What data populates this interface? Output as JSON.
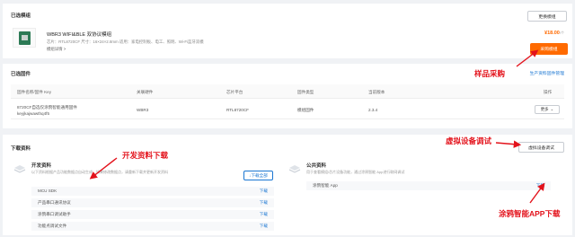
{
  "selected_module": {
    "title": "已选模组",
    "change_label": "更换模组",
    "name": "WBR3 WIFI&BLE 双协议模组",
    "specs": "芯片：RTL8720CF   尺寸：16×24×2.8mm   适用：家电控制板、电工、照明、Wi-Fi蓝牙双模",
    "detail_label": "模组详情 >",
    "price": "¥18.00",
    "price_unit": "/个",
    "buy_label": "采购模组"
  },
  "firmware": {
    "title": "已选固件",
    "manage_label": "生产资料固件管理",
    "columns": [
      "固件名称/固件 Key",
      "关联硬件",
      "芯片平台",
      "固件类型",
      "当前版本",
      "操作"
    ],
    "row": {
      "name": "8720CF自选仅涂鸦智能通用固件",
      "key": "keyjkajwawthq4f5",
      "hardware": "WBR3",
      "chip": "RTL8720CF",
      "type": "模组固件",
      "version": "2.3.4",
      "more_label": "更多"
    }
  },
  "downloads": {
    "title": "下载资料",
    "debug_label": "虚拟设备调试",
    "dev": {
      "title": "开发资料",
      "desc": "以下资料根据产品功能数据点自动生成，如果修改数据点，请重新下载并更新开发资料",
      "download_all_label": "下载全部",
      "items": [
        {
          "name": "MCU SDK",
          "action": "下载"
        },
        {
          "name": "产品串口通讯协议",
          "action": "下载"
        },
        {
          "name": "涂鸦串口调试助手",
          "action": "下载"
        },
        {
          "name": "功能点调试文件",
          "action": "下载"
        }
      ]
    },
    "public": {
      "title": "公共资料",
      "desc": "用于查看模组/芯片设备功能，通过涂鸦智能 App进行联网调试",
      "items": [
        {
          "name": "涂鸦智能 App",
          "action": "下载"
        }
      ]
    }
  },
  "annotations": {
    "sample_purchase": "样品采购",
    "dev_download": "开发资料下载",
    "virtual_debug": "虚拟设备调试",
    "app_download": "涂鸦智能APP下载"
  },
  "colors": {
    "accent_orange": "#ff6a00",
    "link_blue": "#1a76d2",
    "annotation_red": "#e3121b"
  }
}
